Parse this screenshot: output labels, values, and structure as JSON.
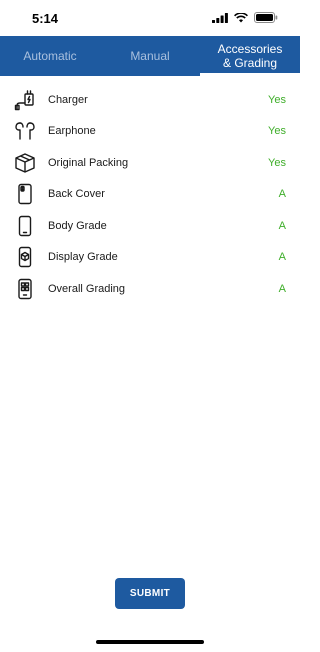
{
  "status": {
    "time": "5:14"
  },
  "tabs": [
    {
      "label": "Automatic"
    },
    {
      "label": "Manual"
    },
    {
      "label": "Accessories\n& Grading"
    }
  ],
  "items": [
    {
      "label": "Charger",
      "value": "Yes",
      "icon": "charger-icon"
    },
    {
      "label": "Earphone",
      "value": "Yes",
      "icon": "earphone-icon"
    },
    {
      "label": "Original Packing",
      "value": "Yes",
      "icon": "box-icon"
    },
    {
      "label": "Back Cover",
      "value": "A",
      "icon": "back-cover-icon"
    },
    {
      "label": "Body Grade",
      "value": "A",
      "icon": "phone-body-icon"
    },
    {
      "label": "Display Grade",
      "value": "A",
      "icon": "display-icon"
    },
    {
      "label": "Overall Grading",
      "value": "A",
      "icon": "overall-grading-icon"
    }
  ],
  "submit_label": "SUBMIT",
  "colors": {
    "primary": "#1e5aa0",
    "value_green": "#3fae2a"
  }
}
